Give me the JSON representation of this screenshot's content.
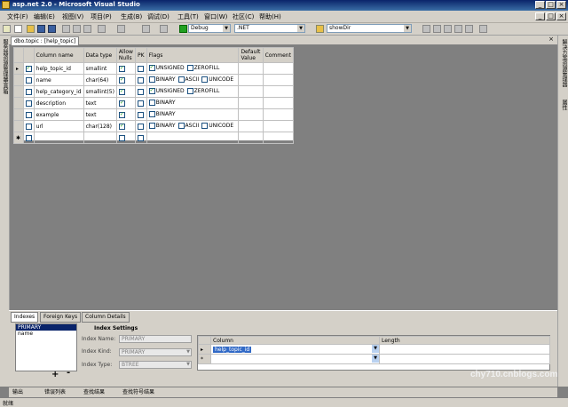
{
  "window": {
    "title": "asp.net 2.0 - Microsoft Visual Studio"
  },
  "menu": [
    "文件(F)",
    "编辑(E)",
    "视图(V)",
    "项目(P)",
    "生成(B)",
    "调试(D)",
    "工具(T)",
    "窗口(W)",
    "社区(C)",
    "帮助(H)"
  ],
  "toolbar": {
    "config": "Debug",
    "platform": ".NET",
    "find": "showDir"
  },
  "doc_tab": "dbo.topic : [help_topic]",
  "grid": {
    "headers": [
      "",
      "",
      "Column name",
      "Data type",
      "Allow Nulls",
      "PK",
      "Flags",
      "Default Value",
      "Comment"
    ],
    "rows": [
      {
        "name": "help_topic_id",
        "type": "smallint",
        "nulls": true,
        "pk": false,
        "flags": [
          [
            "UNSIGNED",
            true
          ],
          [
            "ZEROFILL",
            false
          ]
        ]
      },
      {
        "name": "name",
        "type": "char(64)",
        "nulls": true,
        "pk": false,
        "flags": [
          [
            "BINARY",
            false
          ],
          [
            "ASCII",
            false
          ],
          [
            "UNICODE",
            false
          ]
        ]
      },
      {
        "name": "help_category_id",
        "type": "smallint(5)",
        "nulls": true,
        "pk": false,
        "flags": [
          [
            "UNSIGNED",
            true
          ],
          [
            "ZEROFILL",
            false
          ]
        ]
      },
      {
        "name": "description",
        "type": "text",
        "nulls": true,
        "pk": false,
        "flags": [
          [
            "BINARY",
            false
          ]
        ]
      },
      {
        "name": "example",
        "type": "text",
        "nulls": true,
        "pk": false,
        "flags": [
          [
            "BINARY",
            false
          ]
        ]
      },
      {
        "name": "url",
        "type": "char(128)",
        "nulls": true,
        "pk": false,
        "flags": [
          [
            "BINARY",
            false
          ],
          [
            "ASCII",
            false
          ],
          [
            "UNICODE",
            false
          ]
        ]
      },
      {
        "name": "",
        "type": "",
        "nulls": false,
        "pk": false,
        "flags": []
      }
    ]
  },
  "bottom": {
    "tabs": [
      "Indexes",
      "Foreign Keys",
      "Column Details"
    ],
    "index_list": [
      "PRIMARY",
      "name"
    ],
    "settings_title": "Index Settings",
    "labels": [
      "Index Name:",
      "Index Kind:",
      "Index Type:"
    ],
    "values": [
      "PRIMARY",
      "PRIMARY",
      "BTREE"
    ],
    "plus": "+",
    "minus": "-",
    "col_headers": [
      "Column",
      "Length"
    ],
    "col_rows": [
      [
        "help_topic_id",
        ""
      ],
      [
        "",
        ""
      ]
    ]
  },
  "left_strip": [
    "服务器资源管理器",
    "工具箱"
  ],
  "right_strip": [
    "解决方案资源管理器",
    "属性"
  ],
  "bottom_tabs": [
    "输出",
    "错误列表",
    "查找结果",
    "查找符号结果"
  ],
  "status": "就绪",
  "watermark": "chy710.cnblogs.com"
}
